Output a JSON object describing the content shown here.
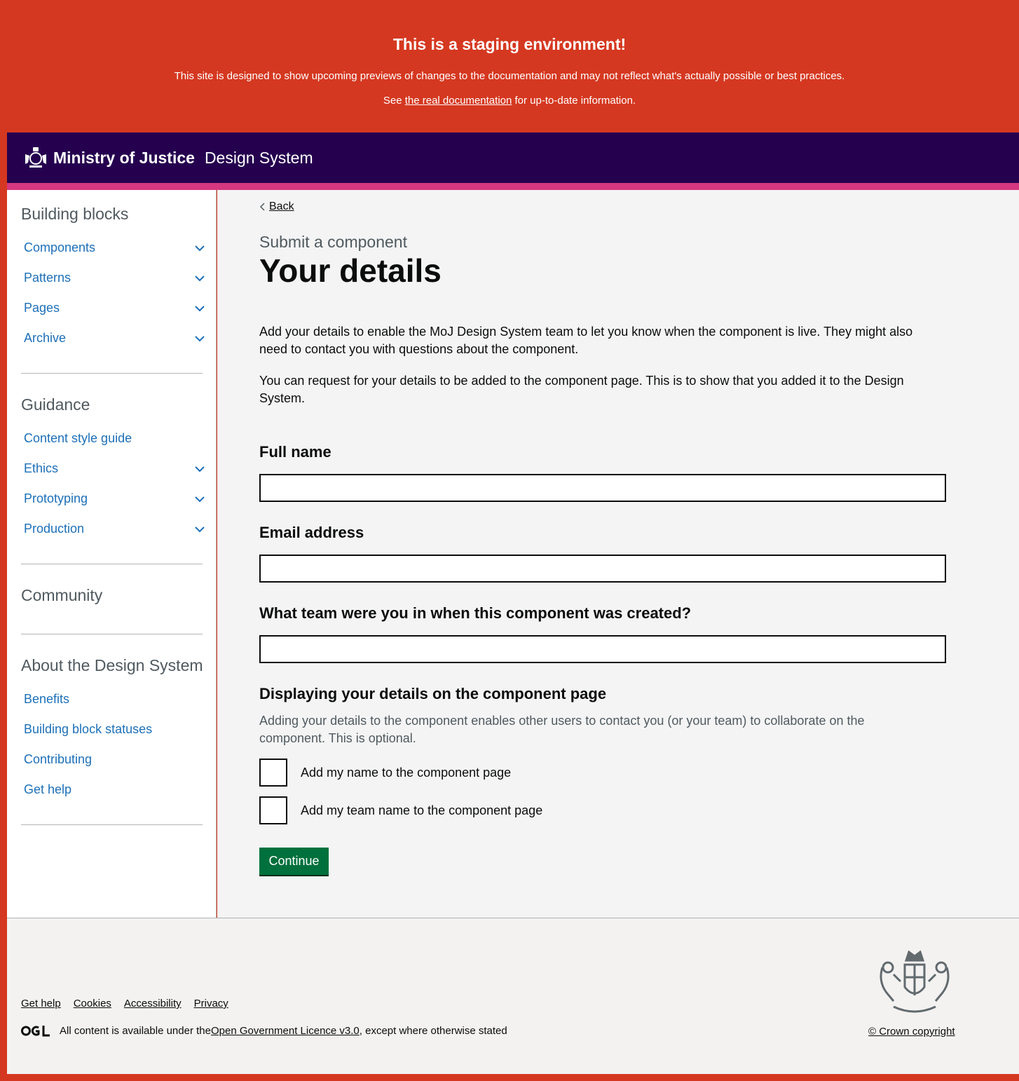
{
  "staging": {
    "title": "This is a staging environment!",
    "line1": "This site is designed to show upcoming previews of changes to the documentation and may not reflect what's actually possible or best practices.",
    "line2_prefix": "See ",
    "line2_link": "the real documentation",
    "line2_suffix": " for up-to-date information."
  },
  "header": {
    "brand": "Ministry of Justice",
    "service": "Design System",
    "colors": {
      "bar": "#25004f",
      "strip": "#d53880"
    }
  },
  "sidebar": {
    "sections": [
      {
        "heading": "Building blocks",
        "items": [
          {
            "label": "Components",
            "expandable": true
          },
          {
            "label": "Patterns",
            "expandable": true
          },
          {
            "label": "Pages",
            "expandable": true
          },
          {
            "label": "Archive",
            "expandable": true
          }
        ]
      },
      {
        "heading": "Guidance",
        "items": [
          {
            "label": "Content style guide",
            "expandable": false
          },
          {
            "label": "Ethics",
            "expandable": true
          },
          {
            "label": "Prototyping",
            "expandable": true
          },
          {
            "label": "Production",
            "expandable": true
          }
        ]
      },
      {
        "heading": "Community",
        "items": []
      },
      {
        "heading": "About the Design System",
        "items": [
          {
            "label": "Benefits",
            "expandable": false
          },
          {
            "label": "Building block statuses",
            "expandable": false
          },
          {
            "label": "Contributing",
            "expandable": false
          },
          {
            "label": "Get help",
            "expandable": false
          }
        ]
      }
    ]
  },
  "main": {
    "back": "Back",
    "caption": "Submit a component",
    "title": "Your details",
    "intro1": "Add your details to enable the MoJ Design System team to let you know when the component is live. They might also need to contact you with questions about the component.",
    "intro2": "You can request for your details to be added to the component page. This is to show that you added it to the Design System.",
    "fields": [
      {
        "label": "Full name",
        "value": ""
      },
      {
        "label": "Email address",
        "value": ""
      },
      {
        "label": "What team were you in when this component was created?",
        "value": ""
      }
    ],
    "display": {
      "heading": "Displaying your details on the component page",
      "hint": "Adding your details to the component enables other users to contact you (or your team) to collaborate on the component. This is optional.",
      "options": [
        {
          "label": "Add my name to the component page",
          "checked": false
        },
        {
          "label": "Add my team name to the component page",
          "checked": false
        }
      ]
    },
    "continue": "Continue",
    "colors": {
      "button": "#00703c",
      "link": "#1d70b8"
    }
  },
  "footer": {
    "links": [
      "Get help",
      "Cookies",
      "Accessibility",
      "Privacy"
    ],
    "licence_prefix": "All content is available under the ",
    "licence_link": "Open Government Licence v3.0",
    "licence_suffix": ", except where otherwise stated",
    "copyright": "© Crown copyright"
  }
}
